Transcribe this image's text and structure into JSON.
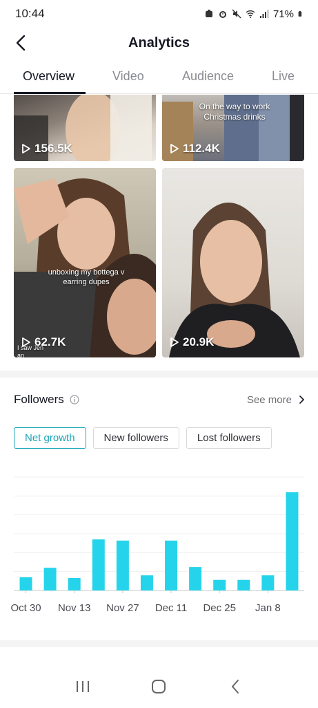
{
  "status": {
    "time": "10:44",
    "battery": "71%"
  },
  "header": {
    "title": "Analytics"
  },
  "tabs": [
    {
      "label": "Overview",
      "active": true
    },
    {
      "label": "Video",
      "active": false
    },
    {
      "label": "Audience",
      "active": false
    },
    {
      "label": "Live",
      "active": false
    }
  ],
  "videos": [
    {
      "views": "156.5K",
      "caption": ""
    },
    {
      "views": "112.4K",
      "caption": "On the way to work\nChristmas drinks"
    },
    {
      "views": "62.7K",
      "caption": "unboxing my bottega v\nearring dupes",
      "corner_text": "I saw Jen an\num"
    },
    {
      "views": "20.9K",
      "caption": ""
    }
  ],
  "followers": {
    "title": "Followers",
    "see_more": "See more",
    "filters": [
      "Net growth",
      "New followers",
      "Lost followers"
    ],
    "active_filter": "Net growth"
  },
  "colors": {
    "accent": "#1aa5b8",
    "bar": "#25d4ea"
  },
  "chart_data": {
    "type": "bar",
    "tick_labels": [
      "Oct 30",
      "Nov 13",
      "Nov 27",
      "Dec 11",
      "Dec 25",
      "Jan 8"
    ],
    "values": [
      3.5,
      6.0,
      3.3,
      13.5,
      13.2,
      4.0,
      13.2,
      6.2,
      2.8,
      2.8,
      4.0,
      26.0
    ],
    "ylim": [
      0,
      30
    ],
    "grid": true,
    "xlabel": "",
    "ylabel": ""
  },
  "nav": {
    "recents": "recents-icon",
    "home": "home-icon",
    "back": "back-icon"
  }
}
